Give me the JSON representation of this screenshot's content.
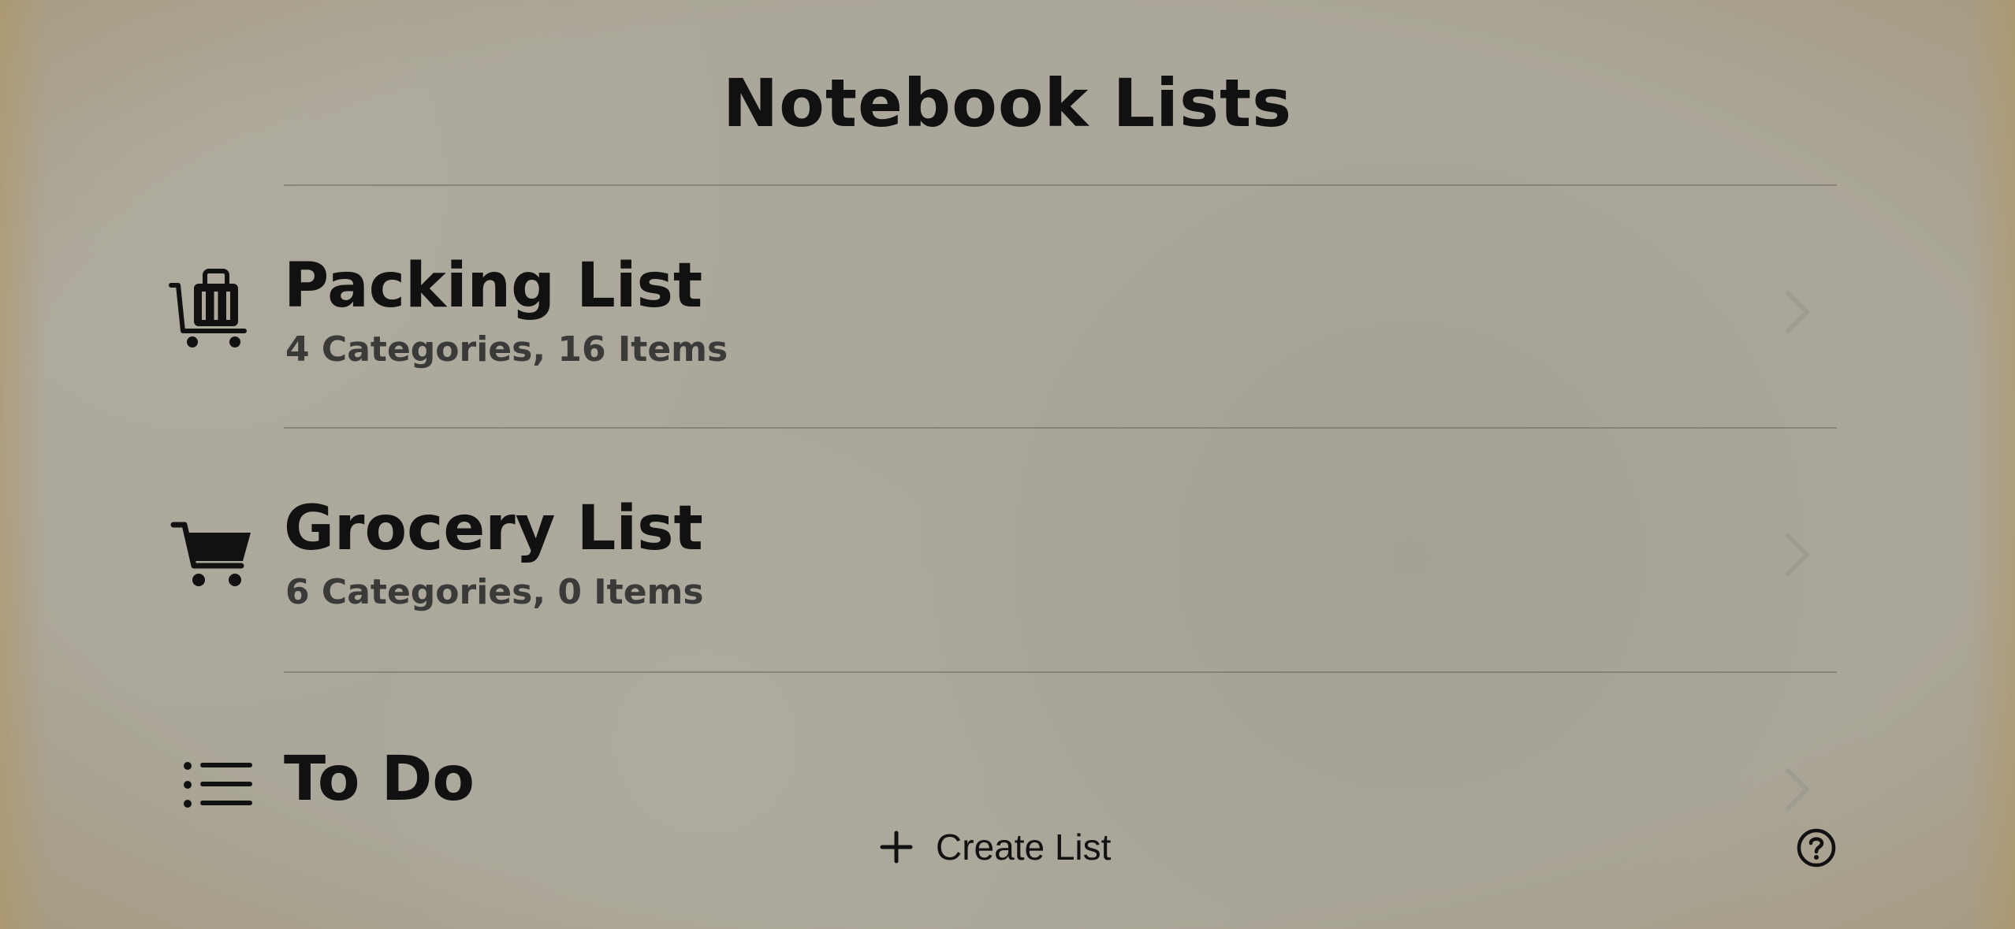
{
  "header": {
    "title": "Notebook Lists"
  },
  "lists": [
    {
      "title": "Packing List",
      "subtitle": "4 Categories, 16 Items",
      "icon": "suitcase-cart-icon"
    },
    {
      "title": "Grocery List",
      "subtitle": "6 Categories, 0 Items",
      "icon": "shopping-cart-icon"
    },
    {
      "title": "To Do",
      "subtitle": "",
      "icon": "list-bullet-icon"
    }
  ],
  "toolbar": {
    "create_label": "Create List",
    "create_icon": "plus-icon",
    "help_icon": "help-circle-icon"
  },
  "colors": {
    "background": "#aba79a",
    "text": "#111111",
    "subtitle": "#3a3a38",
    "divider": "#5a5a55"
  }
}
